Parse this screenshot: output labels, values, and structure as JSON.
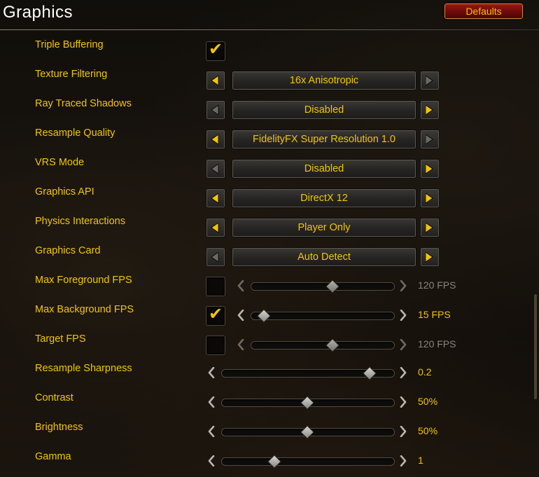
{
  "header": {
    "title": "Graphics",
    "defaults_label": "Defaults"
  },
  "colors": {
    "accent": "#f0c700",
    "dim": "#8a8478",
    "defaults_bg": "#8a1010"
  },
  "rows": [
    {
      "label": "Triple Buffering",
      "type": "checkbox",
      "checked": true
    },
    {
      "label": "Texture Filtering",
      "type": "dropdown",
      "value": "16x Anisotropic",
      "left_enabled": true,
      "right_enabled": false
    },
    {
      "label": "Ray Traced Shadows",
      "type": "dropdown",
      "value": "Disabled",
      "left_enabled": false,
      "right_enabled": true
    },
    {
      "label": "Resample Quality",
      "type": "dropdown",
      "value": "FidelityFX Super Resolution 1.0",
      "left_enabled": true,
      "right_enabled": false
    },
    {
      "label": "VRS Mode",
      "type": "dropdown",
      "value": "Disabled",
      "left_enabled": false,
      "right_enabled": true
    },
    {
      "label": "Graphics API",
      "type": "dropdown",
      "value": "DirectX 12",
      "left_enabled": true,
      "right_enabled": true
    },
    {
      "label": "Physics Interactions",
      "type": "dropdown",
      "value": "Player Only",
      "left_enabled": true,
      "right_enabled": true
    },
    {
      "label": "Graphics Card",
      "type": "dropdown",
      "value": "Auto Detect",
      "left_enabled": false,
      "right_enabled": true
    },
    {
      "label": "Max Foreground FPS",
      "type": "check_slider",
      "checked": false,
      "value_text": "120 FPS",
      "level": 0.58,
      "enabled": false
    },
    {
      "label": "Max Background FPS",
      "type": "check_slider",
      "checked": true,
      "value_text": "15 FPS",
      "level": 0.07,
      "enabled": true
    },
    {
      "label": "Target FPS",
      "type": "check_slider",
      "checked": false,
      "value_text": "120 FPS",
      "level": 0.58,
      "enabled": false
    },
    {
      "label": "Resample Sharpness",
      "type": "slider",
      "value_text": "0.2",
      "level": 0.88
    },
    {
      "label": "Contrast",
      "type": "slider",
      "value_text": "50%",
      "level": 0.5
    },
    {
      "label": "Brightness",
      "type": "slider",
      "value_text": "50%",
      "level": 0.5
    },
    {
      "label": "Gamma",
      "type": "slider",
      "value_text": "1",
      "level": 0.3
    }
  ]
}
